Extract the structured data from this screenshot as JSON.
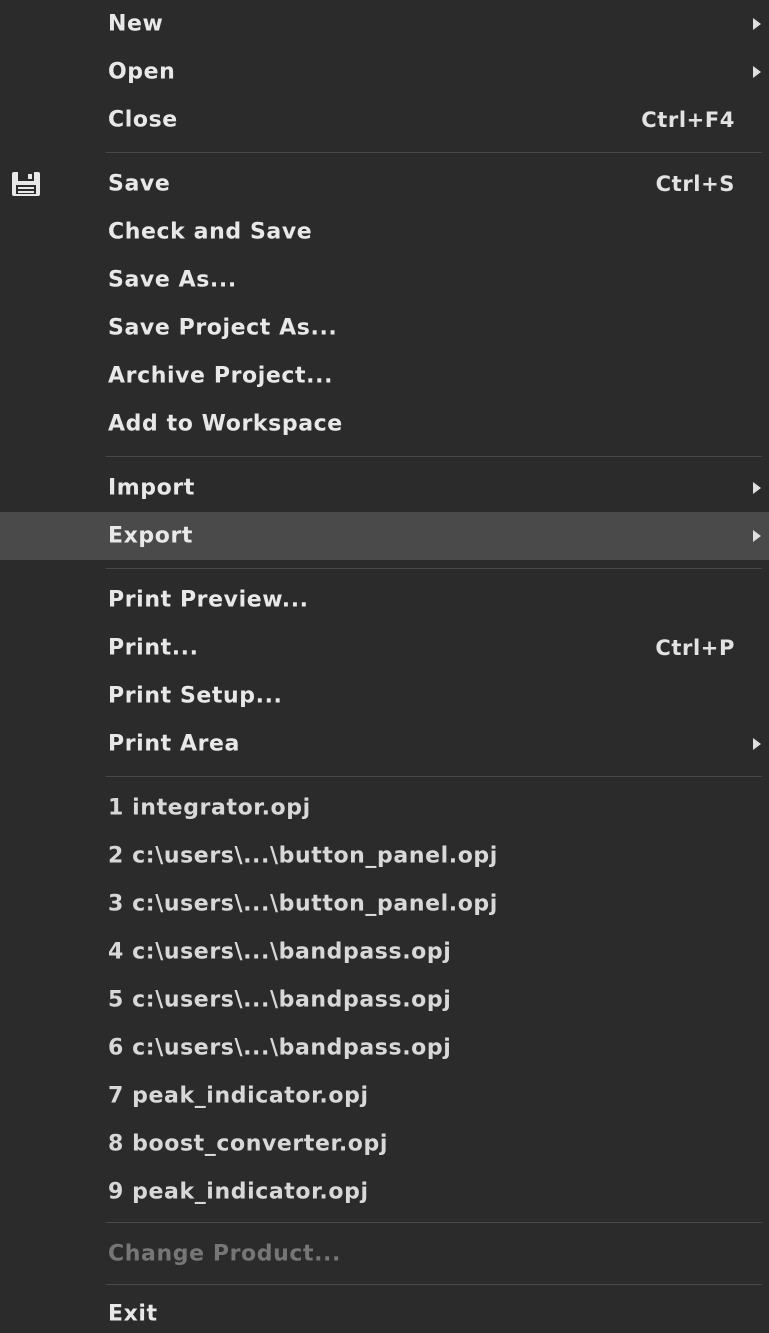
{
  "menu": {
    "items": [
      {
        "label": "New"
      },
      {
        "label": "Open"
      },
      {
        "label": "Close",
        "shortcut": "Ctrl+F4"
      },
      {
        "label": "Save",
        "shortcut": "Ctrl+S",
        "icon": "floppy-disk-icon"
      },
      {
        "label": "Check and Save"
      },
      {
        "label": "Save As..."
      },
      {
        "label": "Save Project As..."
      },
      {
        "label": "Archive Project..."
      },
      {
        "label": "Add to Workspace"
      },
      {
        "label": "Import"
      },
      {
        "label": "Export",
        "highlighted": true
      },
      {
        "label": "Print Preview..."
      },
      {
        "label": "Print...",
        "shortcut": "Ctrl+P"
      },
      {
        "label": "Print Setup..."
      },
      {
        "label": "Print Area"
      },
      {
        "label": "1 integrator.opj"
      },
      {
        "label": "2 c:\\users\\...\\button_panel.opj"
      },
      {
        "label": "3 c:\\users\\...\\button_panel.opj"
      },
      {
        "label": "4 c:\\users\\...\\bandpass.opj"
      },
      {
        "label": "5 c:\\users\\...\\bandpass.opj"
      },
      {
        "label": "6 c:\\users\\...\\bandpass.opj"
      },
      {
        "label": "7 peak_indicator.opj"
      },
      {
        "label": "8 boost_converter.opj"
      },
      {
        "label": "9 peak_indicator.opj"
      },
      {
        "label": "Change Product...",
        "disabled": true
      },
      {
        "label": "Exit"
      }
    ]
  },
  "colors": {
    "background": "#2b2b2b",
    "highlight": "#4a4a4a",
    "text": "#e8e8e8",
    "disabled_text": "#767676"
  }
}
